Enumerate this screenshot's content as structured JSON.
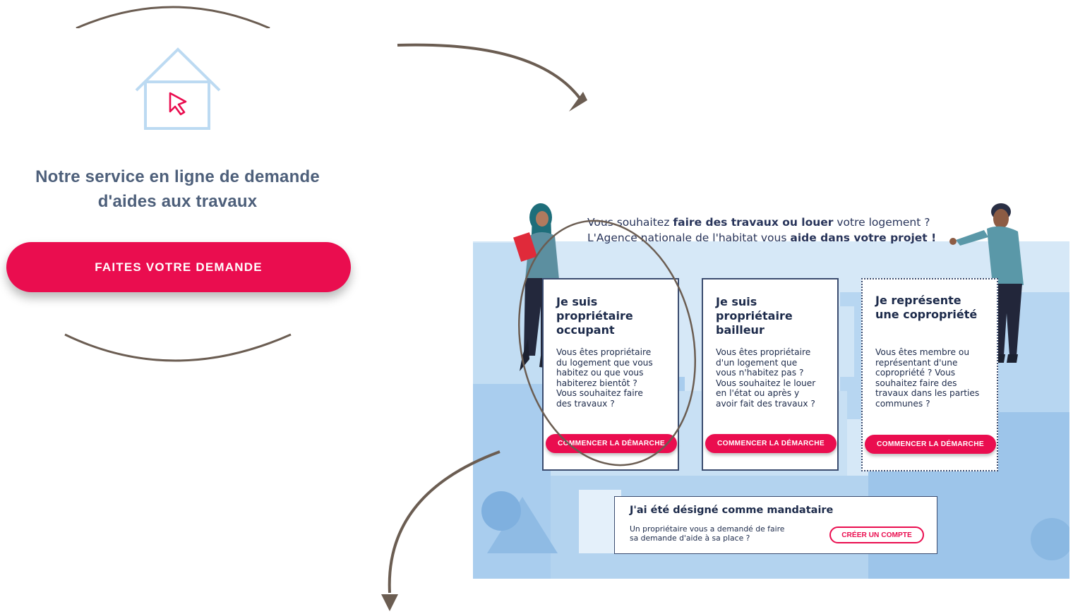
{
  "left_panel": {
    "service_title_line1": "Notre service en ligne de demande",
    "service_title_line2": "d'aides aux travaux",
    "cta_label": "FAITES VOTRE DEMANDE",
    "icon": "house-cursor-icon"
  },
  "hero": {
    "intro_line1_pre": "Vous souhaitez ",
    "intro_line1_bold": "faire des travaux ou louer",
    "intro_line1_post": " votre logement ?",
    "intro_line2_pre": "L'Agence nationale de l'habitat vous ",
    "intro_line2_bold": "aide dans votre projet !",
    "cards": [
      {
        "title_lines": [
          "Je suis",
          "propriétaire",
          "occupant"
        ],
        "body_lines": [
          "Vous êtes propriétaire",
          "du logement que vous",
          "habitez ou que vous",
          "habiterez bientôt ?",
          "Vous souhaitez faire",
          "des travaux ?"
        ],
        "button": "COMMENCER LA DÉMARCHE"
      },
      {
        "title_lines": [
          "Je suis",
          "propriétaire",
          "bailleur"
        ],
        "body_lines": [
          "Vous êtes propriétaire",
          "d'un logement que",
          "vous n'habitez pas ?",
          "Vous souhaitez le louer",
          "en l'état ou après y",
          "avoir fait des travaux ?"
        ],
        "button": "COMMENCER LA DÉMARCHE"
      },
      {
        "title_lines": [
          "Je représente",
          "une copropriété"
        ],
        "body_lines": [
          "Vous êtes membre ou",
          "représentant d'une",
          "copropriété ? Vous",
          "souhaitez faire des",
          "travaux dans les parties",
          "communes ?"
        ],
        "button": "COMMENCER LA DÉMARCHE"
      }
    ],
    "mandataire": {
      "title": "J'ai été désigné comme mandataire",
      "text_line1": "Un propriétaire vous a demandé de faire",
      "text_line2": "sa demande d'aide à sa place ?",
      "button": "CRÉER UN COMPTE"
    }
  },
  "colors": {
    "accent": "#ea0d4f",
    "navy": "#1c2a4a",
    "title_grey": "#4d5f7a",
    "annotation": "#6b5d52",
    "light_blue": "#bcdaf2"
  }
}
